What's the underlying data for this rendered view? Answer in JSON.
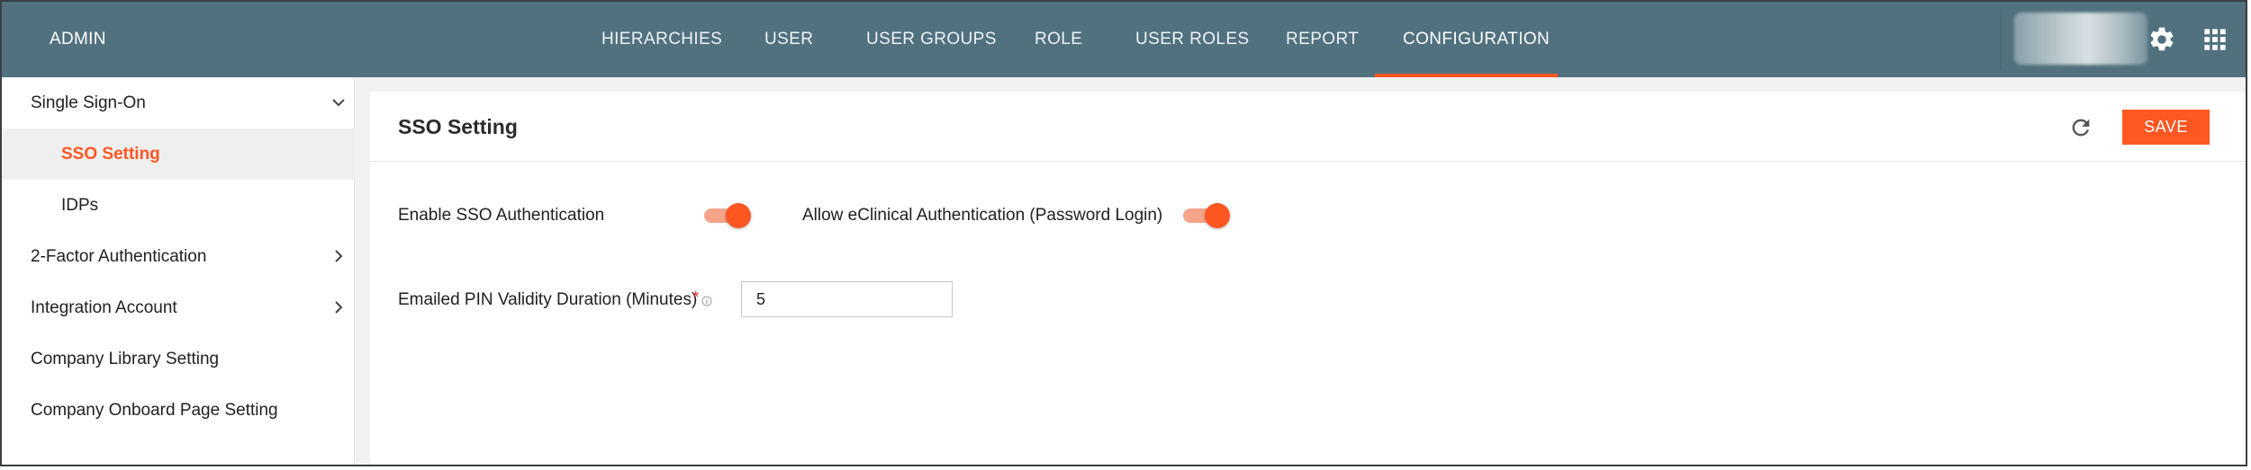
{
  "header": {
    "brand": "ADMIN",
    "nav": [
      {
        "label": "HIERARCHIES",
        "active": false
      },
      {
        "label": "USER",
        "active": false
      },
      {
        "label": "USER GROUPS",
        "active": false
      },
      {
        "label": "ROLE",
        "active": false
      },
      {
        "label": "USER ROLES",
        "active": false
      },
      {
        "label": "REPORT",
        "active": false
      },
      {
        "label": "CONFIGURATION",
        "active": true
      }
    ],
    "icons": {
      "settings": "gear-icon",
      "apps": "apps-grid-icon"
    }
  },
  "sidebar": {
    "items": [
      {
        "label": "Single Sign-On",
        "expand": "chevron-down-icon"
      },
      {
        "label": "SSO Setting",
        "selected": true
      },
      {
        "label": "IDPs"
      },
      {
        "label": "2-Factor Authentication",
        "expand": "chevron-right-icon"
      },
      {
        "label": "Integration Account",
        "expand": "chevron-right-icon"
      },
      {
        "label": "Company Library Setting"
      },
      {
        "label": "Company Onboard Page Setting"
      }
    ]
  },
  "main": {
    "title": "SSO Setting",
    "save_label": "SAVE",
    "refresh_icon": "refresh-icon",
    "enable_sso": {
      "label": "Enable SSO Authentication",
      "on": true
    },
    "allow_eclinical": {
      "label": "Allow eClinical Authentication (Password Login)",
      "on": true
    },
    "pin_validity": {
      "label": "Emailed PIN Validity Duration (Minutes)",
      "required_mark": "*",
      "value": "5"
    }
  },
  "colors": {
    "topbar": "#51717f",
    "accent": "#ff5722",
    "toggle_track": "#f6a48a",
    "sidebar_selected_bg": "#efefef"
  }
}
